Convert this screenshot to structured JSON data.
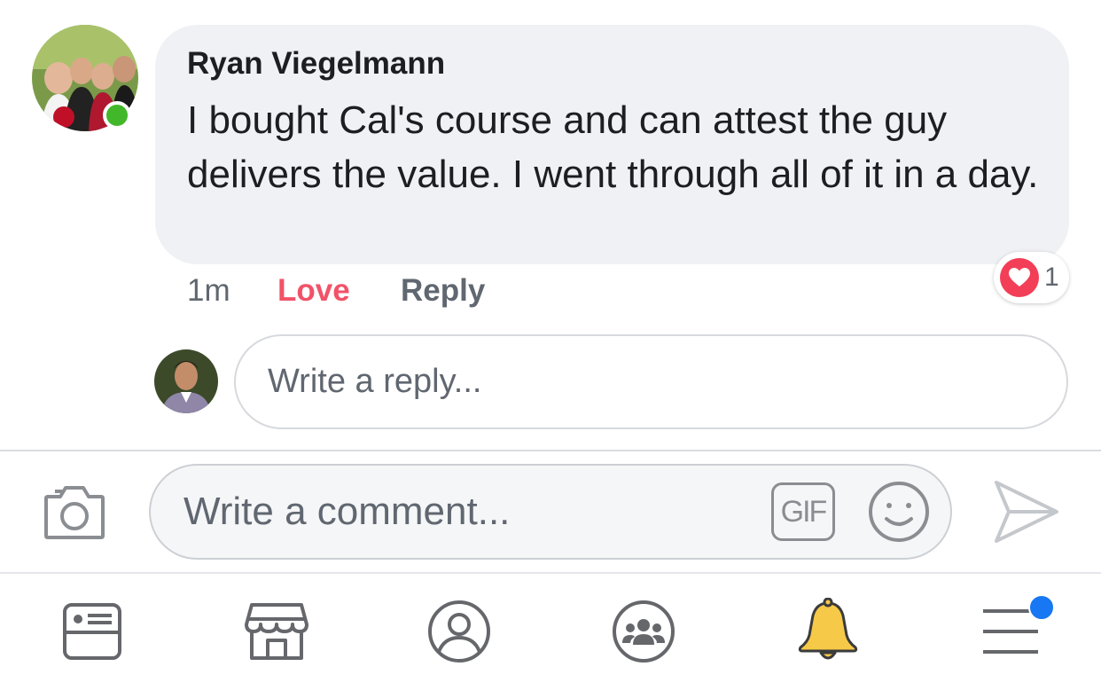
{
  "comment": {
    "author": "Ryan Viegelmann",
    "text": "I bought Cal's course and can attest the guy delivers the value. I went through all of it in a day.",
    "time": "1m",
    "love_label": "Love",
    "reply_label": "Reply",
    "reaction_count": "1",
    "reaction_type": "heart-icon",
    "online": true
  },
  "reply": {
    "placeholder": "Write a reply..."
  },
  "composer": {
    "placeholder": "Write a comment...",
    "gif_label": "GIF",
    "camera_icon": "camera-icon",
    "emoji_icon": "smiley-icon",
    "send_icon": "send-icon"
  },
  "bottom_nav": {
    "items": [
      {
        "name": "news-feed",
        "icon": "news-feed-icon"
      },
      {
        "name": "marketplace",
        "icon": "marketplace-icon"
      },
      {
        "name": "profile",
        "icon": "profile-icon"
      },
      {
        "name": "groups",
        "icon": "groups-icon"
      },
      {
        "name": "notifications",
        "icon": "bell-icon",
        "active": true
      },
      {
        "name": "menu",
        "icon": "menu-icon",
        "badge": true
      }
    ]
  },
  "colors": {
    "love": "#f25268",
    "online": "#42b72a",
    "bubble": "#f0f1f4",
    "bell": "#f7c948",
    "badge": "#1877f2"
  }
}
